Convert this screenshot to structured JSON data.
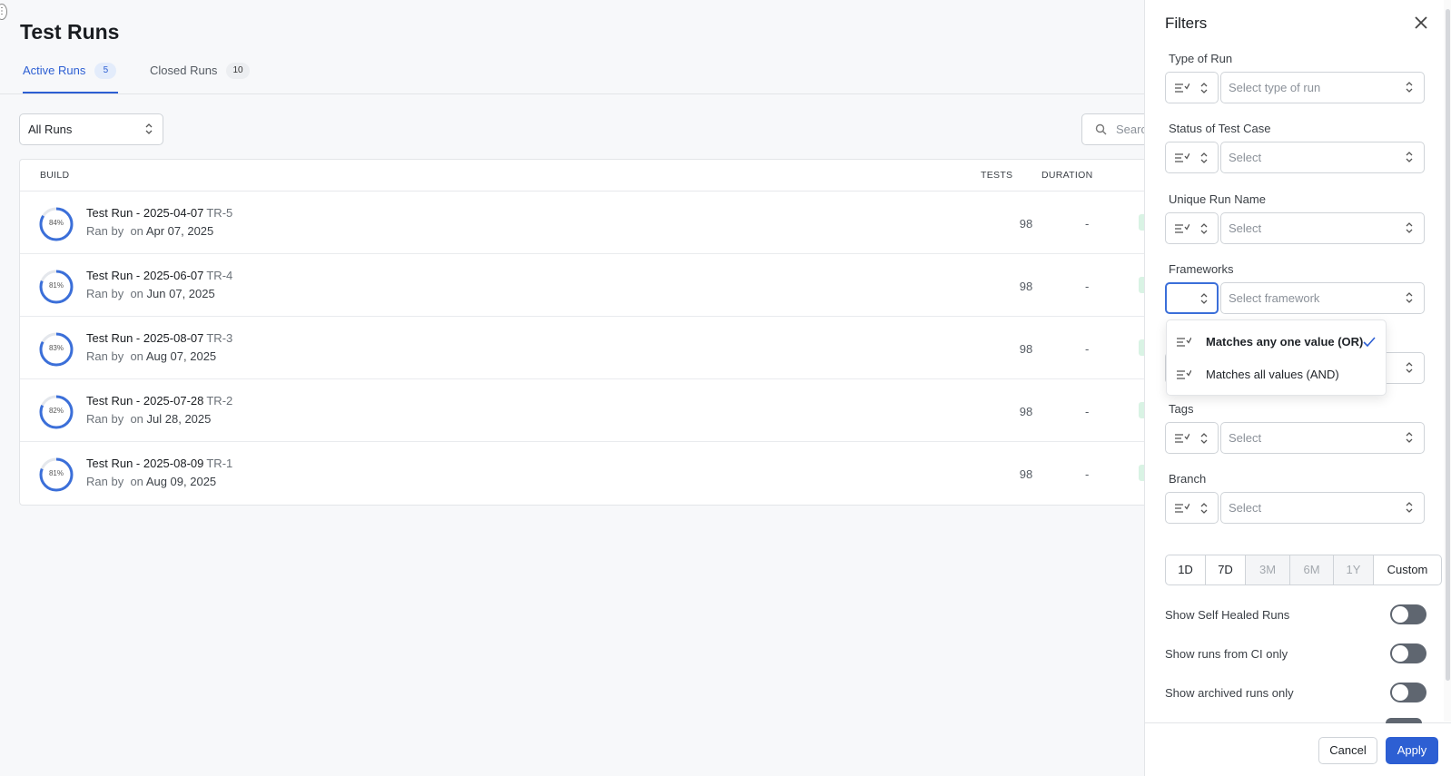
{
  "page": {
    "title": "Test Runs"
  },
  "tabs": [
    {
      "label": "Active Runs",
      "count": "5"
    },
    {
      "label": "Closed Runs",
      "count": "10"
    }
  ],
  "toolbar": {
    "runs_filter": "All Runs",
    "search_placeholder": "Search"
  },
  "table": {
    "headers": {
      "build": "BUILD",
      "tests": "TESTS",
      "duration": "DURATION"
    },
    "rows": [
      {
        "progress": 84,
        "pct": "84%",
        "name": "Test Run - 2025-04-07",
        "id": "TR-5",
        "ran_by": "Ran by",
        "on": "on",
        "date": "Apr 07, 2025",
        "tests": "98",
        "duration": "-"
      },
      {
        "progress": 81,
        "pct": "81%",
        "name": "Test Run - 2025-06-07",
        "id": "TR-4",
        "ran_by": "Ran by",
        "on": "on",
        "date": "Jun 07, 2025",
        "tests": "98",
        "duration": "-"
      },
      {
        "progress": 83,
        "pct": "83%",
        "name": "Test Run - 2025-08-07",
        "id": "TR-3",
        "ran_by": "Ran by",
        "on": "on",
        "date": "Aug 07, 2025",
        "tests": "98",
        "duration": "-"
      },
      {
        "progress": 82,
        "pct": "82%",
        "name": "Test Run - 2025-07-28",
        "id": "TR-2",
        "ran_by": "Ran by",
        "on": "on",
        "date": "Jul 28, 2025",
        "tests": "98",
        "duration": "-"
      },
      {
        "progress": 81,
        "pct": "81%",
        "name": "Test Run - 2025-08-09",
        "id": "TR-1",
        "ran_by": "Ran by",
        "on": "on",
        "date": "Aug 09, 2025",
        "tests": "98",
        "duration": "-"
      }
    ]
  },
  "filters": {
    "title": "Filters",
    "fields": [
      {
        "label": "Type of Run",
        "placeholder": "Select type of run"
      },
      {
        "label": "Status of Test Case",
        "placeholder": "Select"
      },
      {
        "label": "Unique Run Name",
        "placeholder": "Select"
      },
      {
        "label": "Frameworks",
        "placeholder": "Select framework"
      },
      {
        "label": "",
        "placeholder": ""
      },
      {
        "label": "Tags",
        "placeholder": "Select"
      },
      {
        "label": "Branch",
        "placeholder": "Select"
      }
    ],
    "match_options": [
      {
        "label": "Matches any one value (OR)",
        "selected": true
      },
      {
        "label": "Matches all values (AND)",
        "selected": false
      }
    ],
    "date_ranges": [
      {
        "label": "1D",
        "enabled": true
      },
      {
        "label": "7D",
        "enabled": true
      },
      {
        "label": "3M",
        "enabled": false
      },
      {
        "label": "6M",
        "enabled": false
      },
      {
        "label": "1Y",
        "enabled": false
      },
      {
        "label": "Custom",
        "enabled": true
      }
    ],
    "toggles": [
      {
        "label": "Show Self Healed Runs",
        "on": false
      },
      {
        "label": "Show runs from CI only",
        "on": false
      },
      {
        "label": "Show archived runs only",
        "on": false
      }
    ],
    "cancel_label": "Cancel",
    "apply_label": "Apply"
  },
  "colors": {
    "accent": "#2d5fd3",
    "progress_ring": "#3b6fd9",
    "status_pass": "#1f9d55"
  }
}
